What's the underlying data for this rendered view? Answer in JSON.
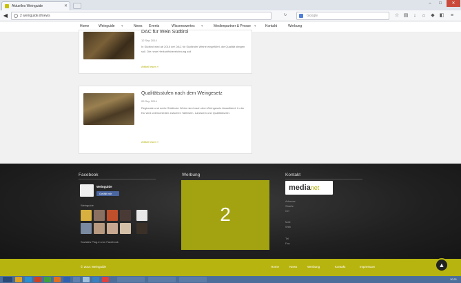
{
  "browser": {
    "tab_title": "Aktuelles Weinguide",
    "url": "2 weinguide.it/news",
    "search_placeholder": "Google"
  },
  "site_nav": {
    "items": [
      "Home",
      "Weinguide",
      "News",
      "Events",
      "Wissenswertes",
      "Medienpartner & Presse",
      "Kontakt",
      "Werbung"
    ]
  },
  "articles": [
    {
      "title": "DAC für Wein Südtirol",
      "date": "12 Sep 2014",
      "text": "In Südtirol wird ab 2015 der DAC für Südtiroler Weine eingeführt, die Qualität steigen soll. Die neue Herkunftsbezeichnung soll",
      "more": "Artikel lesen »"
    },
    {
      "title": "Qualitätsstufen nach dem Weingesetz",
      "date": "09 Sep 2014",
      "text": "Regionale und echte Südtiroler Weine sind nach dem Weingesetz klassifiziert. In der EU wird unterschieden zwischen Tafelwein, Landwein und Qualitätswein.",
      "more": "Artikel lesen »"
    }
  ],
  "footer": {
    "facebook_heading": "Facebook",
    "fb_page_name": "Weinguide",
    "fb_like": "Gefällt mir",
    "fb_fans": "Weinguide",
    "fb_plugin": "Soziales Plug-in von Facebook",
    "ad_heading": "Werbung",
    "ad_number": "2",
    "contact_heading": "Kontakt",
    "contact_logo_main": "media",
    "contact_logo_sub": "net",
    "contact_lines": [
      "Adresse",
      "Straße",
      "Ort",
      "",
      "Mail",
      "Web",
      "",
      "Tel",
      "Fax"
    ]
  },
  "bottom_bar": {
    "copyright": "© 2014 Weinguide",
    "links": [
      "Home",
      "News",
      "Werbung",
      "Kontakt",
      "Impressum"
    ]
  },
  "taskbar": {
    "clock": "10:21"
  }
}
